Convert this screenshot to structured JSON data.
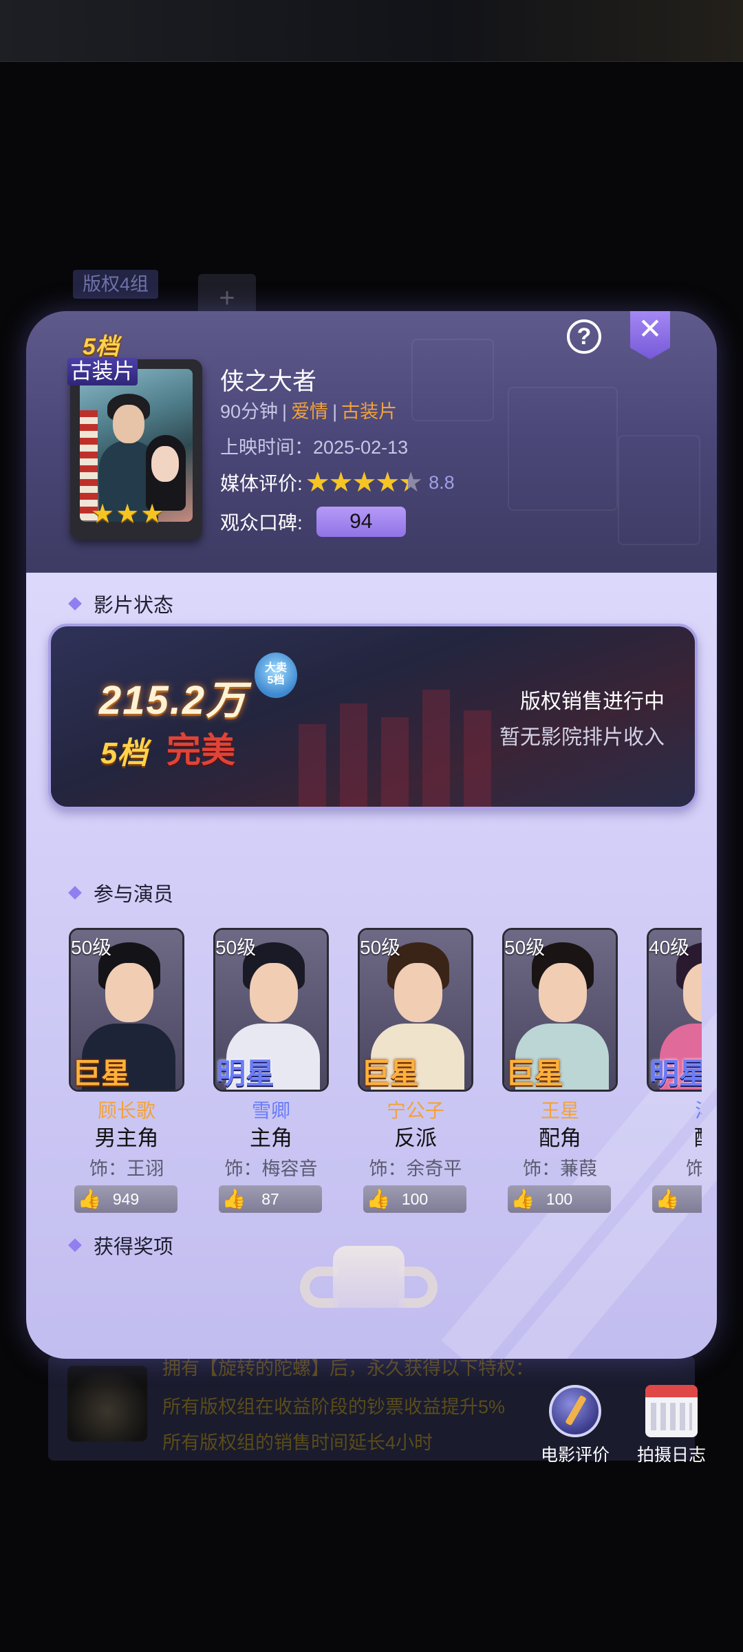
{
  "background": {
    "group_tab": "版权4组",
    "add_label": "+",
    "perk_intro": "拥有【旋转的陀螺】后，永久获得以下特权：",
    "perk_1": "所有版权组在收益阶段的钞票收益提升5%",
    "perk_2": "所有版权组的销售时间延长4小时"
  },
  "film": {
    "tier": "5档",
    "genre_badge": "古装片",
    "title": "侠之大者",
    "duration": "90分钟",
    "tag_1": "爱情",
    "tag_2": "古装片",
    "release_label": "上映时间：",
    "release_date": "2025-02-13",
    "media_label": "媒体评价:",
    "media_score": "8.8",
    "media_score_fraction": 0.88,
    "audience_label": "观众口碑:",
    "audience_score": "94",
    "poster_stars": "★★★"
  },
  "status": {
    "section_title": "影片状态",
    "revenue": "215.2万",
    "badge_text": "大卖",
    "badge_tier": "5档",
    "tier": "5档",
    "grade": "完美",
    "sale_status": "版权销售进行中",
    "cinema_status": "暂无影院排片收入"
  },
  "cast": {
    "section_title": "参与演员",
    "actors": [
      {
        "level": "50级",
        "rank": "巨星",
        "character": "顾长歌",
        "role": "男主角",
        "played_by": "饰：王诩",
        "likes": "949"
      },
      {
        "level": "50级",
        "rank": "明星",
        "character": "雪卿",
        "role": "主角",
        "played_by": "饰：梅容音",
        "likes": "87"
      },
      {
        "level": "50级",
        "rank": "巨星",
        "character": "宁公子",
        "role": "反派",
        "played_by": "饰：余奇平",
        "likes": "100"
      },
      {
        "level": "50级",
        "rank": "巨星",
        "character": "王星",
        "role": "配角",
        "played_by": "饰：蒹葭",
        "likes": "100"
      },
      {
        "level": "40级",
        "rank": "明星",
        "character": "汤",
        "role": "配",
        "played_by": "饰：",
        "likes": ""
      }
    ]
  },
  "awards": {
    "section_title": "获得奖项"
  },
  "buttons": {
    "help": "?",
    "close": "✕",
    "review": "电影评价",
    "diary": "拍摄日志"
  }
}
